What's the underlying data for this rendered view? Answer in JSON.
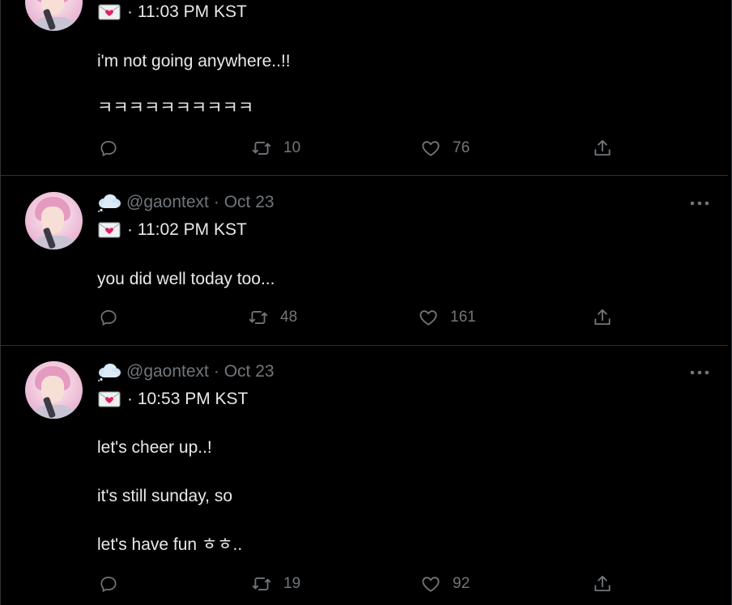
{
  "tweets": [
    {
      "handle": "",
      "date": "",
      "time": "· 11:03 PM KST",
      "lines": [
        "i'm not going anywhere..!!",
        "ㅋㅋㅋㅋㅋㅋㅋㅋㅋㅋ",
        ""
      ],
      "retweets": "10",
      "likes": "76"
    },
    {
      "handle": "@gaontext",
      "date": "· Oct 23",
      "time": "· 11:02 PM KST",
      "lines": [
        "you did well today too...",
        "",
        ""
      ],
      "retweets": "48",
      "likes": "161"
    },
    {
      "handle": "@gaontext",
      "date": "· Oct 23",
      "time": "· 10:53 PM KST",
      "lines": [
        "let's cheer up..!",
        "it's still sunday, so",
        "let's have fun ㅎㅎ.."
      ],
      "retweets": "19",
      "likes": "92"
    }
  ],
  "icons": {
    "reply": "reply-icon",
    "retweet": "retweet-icon",
    "like": "heart-icon",
    "share": "share-icon",
    "more": "more-icon",
    "cloud": "cloud-emoji-icon",
    "envelope": "love-letter-emoji-icon"
  },
  "colors": {
    "background": "#000000",
    "text": "#e7e9ea",
    "muted": "#71767b",
    "divider": "#2f3336"
  }
}
